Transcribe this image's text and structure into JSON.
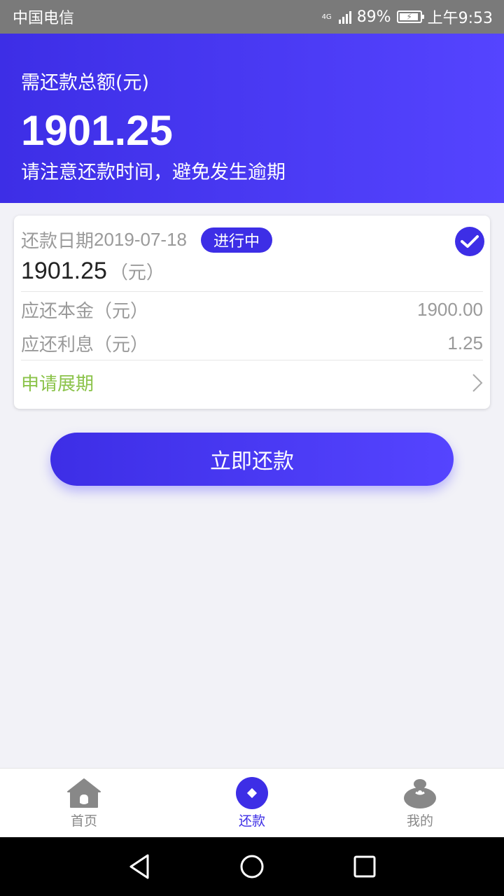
{
  "status_bar": {
    "carrier": "中国电信",
    "network": "4G",
    "battery": "89%",
    "time": "上午9:53"
  },
  "header": {
    "label": "需还款总额(元)",
    "amount": "1901.25",
    "note": "请注意还款时间，避免发生逾期"
  },
  "card": {
    "date_label": "还款日期",
    "date_value": "2019-07-18",
    "status_badge": "进行中",
    "amount": "1901.25",
    "amount_unit": "（元）",
    "principal_label": "应还本金（元）",
    "principal_value": "1900.00",
    "interest_label": "应还利息（元）",
    "interest_value": "1.25",
    "extend_label": "申请展期"
  },
  "pay_button": "立即还款",
  "tabs": [
    {
      "label": "首页",
      "icon": "home-icon",
      "active": false
    },
    {
      "label": "还款",
      "icon": "repay-icon",
      "active": true
    },
    {
      "label": "我的",
      "icon": "profile-icon",
      "active": false
    }
  ],
  "colors": {
    "primary": "#3d2ee6",
    "accent_green": "#8bc34a",
    "status_bar": "#7a7a7a"
  }
}
